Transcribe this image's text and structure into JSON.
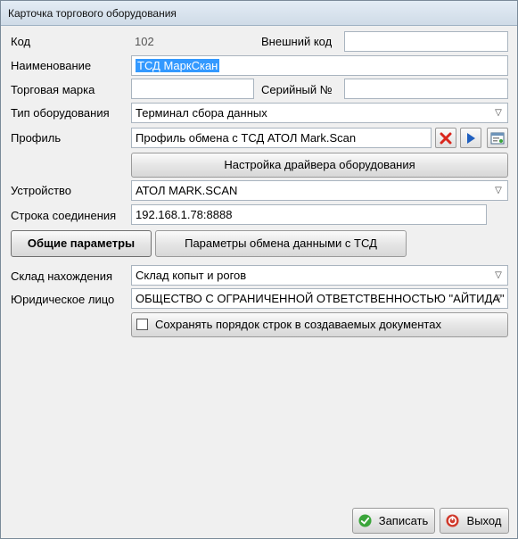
{
  "window": {
    "title": "Карточка торгового оборудования"
  },
  "labels": {
    "code": "Код",
    "external_code": "Внешний код",
    "name": "Наименование",
    "brand": "Торговая марка",
    "serial": "Серийный №",
    "equipment_type": "Тип оборудования",
    "profile": "Профиль",
    "device": "Устройство",
    "connection": "Строка соединения",
    "warehouse": "Склад нахождения",
    "legal_entity": "Юридическое лицо"
  },
  "values": {
    "code": "102",
    "external_code": "",
    "name": "ТСД МаркСкан",
    "brand": "",
    "serial": "",
    "equipment_type": "Терминал сбора данных",
    "profile": "Профиль обмена с ТСД АТОЛ Mark.Scan",
    "device": "АТОЛ MARK.SCAN",
    "connection": "192.168.1.78:8888",
    "warehouse": "Склад копыт и рогов",
    "legal_entity": "ОБЩЕСТВО С ОГРАНИЧЕННОЙ ОТВЕТСТВЕННОСТЬЮ \"АЙТИДА\""
  },
  "buttons": {
    "driver_setup": "Настройка драйвера оборудования",
    "general_params": "Общие параметры",
    "exchange_params": "Параметры обмена данными с ТСД",
    "save": "Записать",
    "exit": "Выход"
  },
  "checkbox": {
    "keep_order_label": "Сохранять порядок строк в создаваемых документах",
    "keep_order_checked": false
  },
  "icons": {
    "clear": "red-x-icon",
    "open": "blue-play-icon",
    "edit": "form-icon",
    "dropdown": "chevron-down-icon",
    "save": "green-check-icon",
    "exit": "red-stop-icon"
  },
  "colors": {
    "selection": "#3399ff",
    "clear_icon": "#d9261c",
    "open_icon": "#1f5fbf",
    "save_icon": "#3aa53a",
    "exit_icon": "#d03a2c"
  }
}
